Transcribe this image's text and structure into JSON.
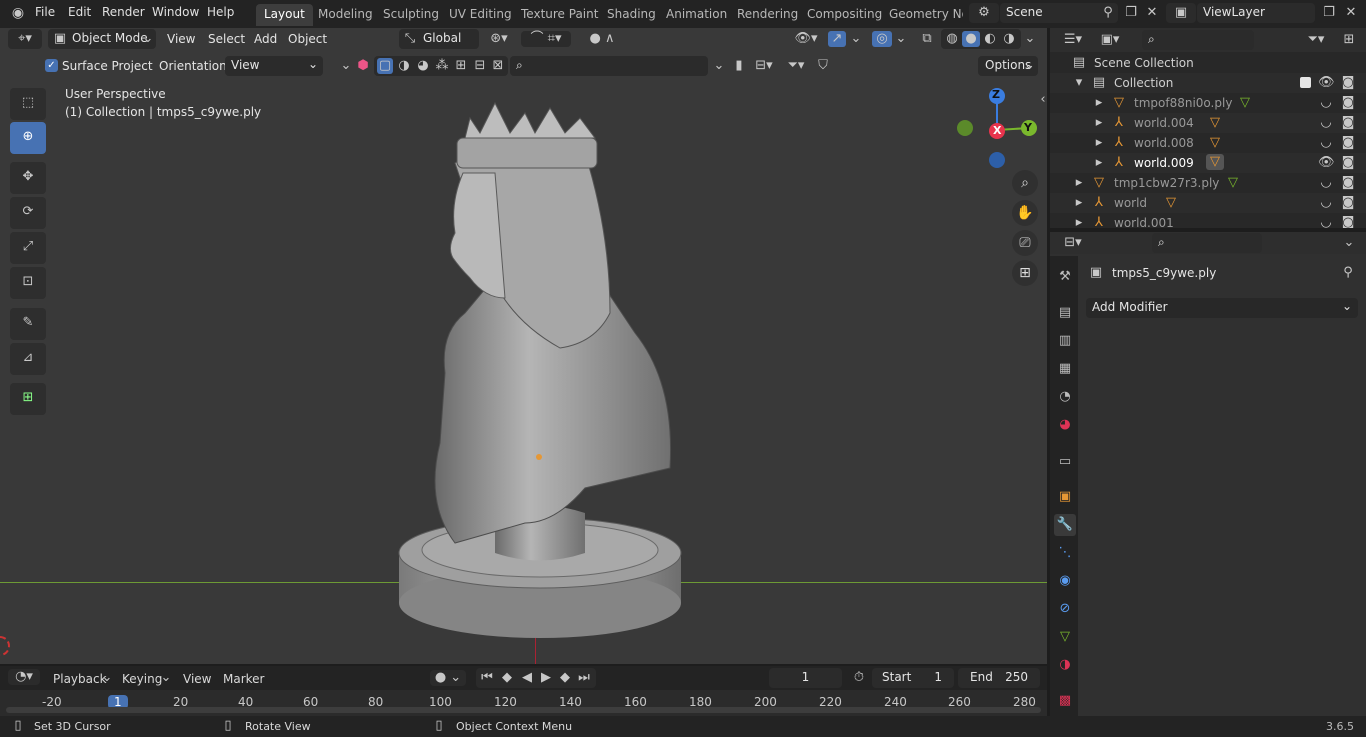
{
  "topbar": {
    "menus": [
      "File",
      "Edit",
      "Render",
      "Window",
      "Help"
    ],
    "workspaces": [
      "Layout",
      "Modeling",
      "Sculpting",
      "UV Editing",
      "Texture Paint",
      "Shading",
      "Animation",
      "Rendering",
      "Compositing",
      "Geometry Noc"
    ],
    "scene": "Scene",
    "view_layer": "ViewLayer"
  },
  "viewport_header": {
    "mode": "Object Mode",
    "menus": [
      "View",
      "Select",
      "Add",
      "Object"
    ],
    "orientation_global": "Global"
  },
  "tool_header": {
    "surface_project": "Surface Project",
    "orientation_label": "Orientation:",
    "orientation_value": "View",
    "options": "Options"
  },
  "viewport": {
    "perspective": "User Perspective",
    "collection_label": "(1) Collection | tmps5_c9ywe.ply",
    "gizmo": {
      "z": "Z",
      "x": "X",
      "y": "Y"
    }
  },
  "outliner": {
    "root": "Scene Collection",
    "rows": [
      {
        "label": "Collection",
        "indent": 1
      },
      {
        "label": "tmpof88ni0o.ply",
        "indent": 2
      },
      {
        "label": "world.004",
        "indent": 2
      },
      {
        "label": "world.008",
        "indent": 2
      },
      {
        "label": "world.009",
        "indent": 2
      },
      {
        "label": "tmp1cbw27r3.ply",
        "indent": 1
      },
      {
        "label": "world",
        "indent": 1
      },
      {
        "label": "world.001",
        "indent": 1
      }
    ]
  },
  "properties": {
    "object_name": "tmps5_c9ywe.ply",
    "add_modifier": "Add Modifier"
  },
  "timeline": {
    "menus": [
      "Playback",
      "Keying",
      "View",
      "Marker"
    ],
    "current_frame": "1",
    "start_label": "Start",
    "start_value": "1",
    "end_label": "End",
    "end_value": "250",
    "ruler": [
      "-20",
      "1",
      "20",
      "40",
      "60",
      "80",
      "100",
      "120",
      "140",
      "160",
      "180",
      "200",
      "220",
      "240",
      "260",
      "280"
    ]
  },
  "statusbar": {
    "hint1": "Set 3D Cursor",
    "hint2": "Rotate View",
    "hint3": "Object Context Menu",
    "version": "3.6.5"
  },
  "colors": {
    "accent": "#4772b3",
    "object_orange": "#e59735",
    "x_axis": "#e8344d",
    "y_axis": "#7ab82d",
    "z_axis": "#3a7de0"
  }
}
